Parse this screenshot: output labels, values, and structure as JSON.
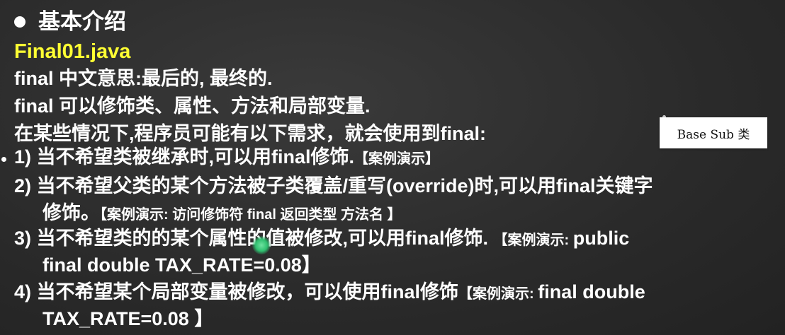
{
  "slide": {
    "heading": "基本介绍",
    "filename": "Final01.java",
    "intro": [
      "final 中文意思:最后的, 最终的.",
      "final 可以修饰类、属性、方法和局部变量.",
      "在某些情况下,程序员可能有以下需求，就会使用到final:"
    ],
    "items": [
      {
        "main": "1) 当不希望类被继承时,可以用final修饰.",
        "demo": "【案例演示】"
      },
      {
        "main": "2) 当不希望父类的某个方法被子类覆盖/重写(override)时,可以用final关键字",
        "cont": "修饰。",
        "demo": "【案例演示: 访问修饰符 final 返回类型 方法名 】"
      },
      {
        "main": "3) 当不希望类的的某个属性的值被修改,可以用final修饰. ",
        "demo": "【案例演示: ",
        "demo_tail": "public",
        "cont": "final double TAX_RATE=0.08】"
      },
      {
        "main": "4) 当不希望某个局部变量被修改，可以使用final修饰",
        "demo": "【案例演示: ",
        "demo_tail": "final double",
        "cont": "TAX_RATE=0.08 】"
      }
    ],
    "note": "Base Sub 类"
  }
}
